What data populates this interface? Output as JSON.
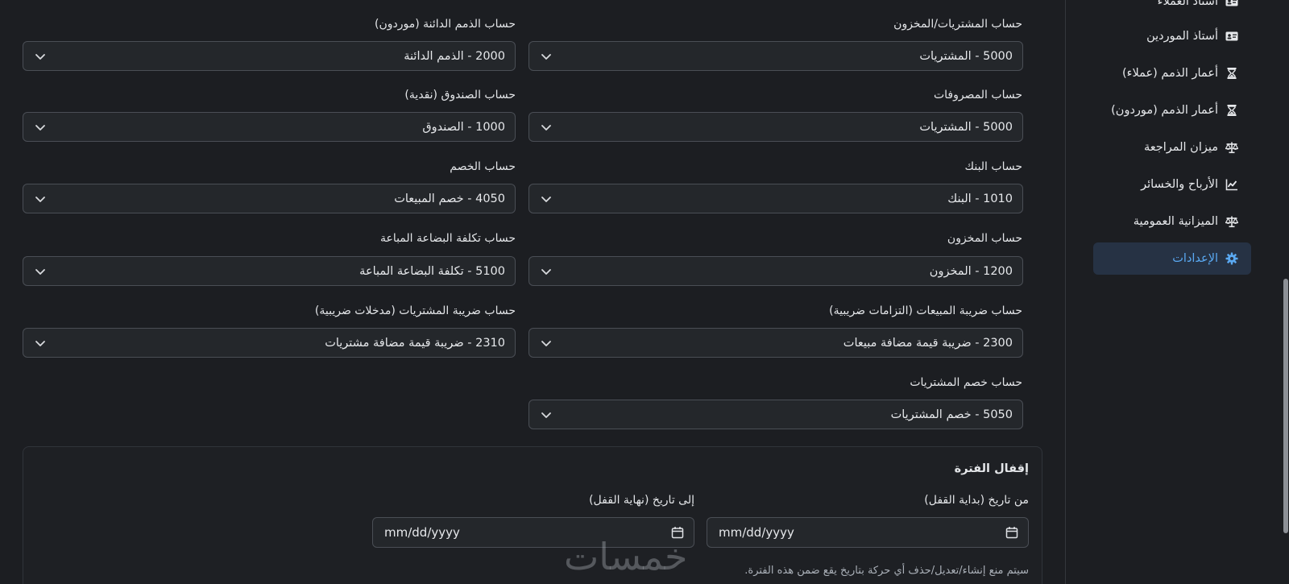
{
  "accounts": {
    "payables_label": "حساب الذمم الدائنة (موردون)",
    "payables_value": "2000 - الذمم الدائنة",
    "purchases_label": "حساب المشتريات/المخزون",
    "purchases_value": "5000 - المشتريات",
    "cash_label": "حساب الصندوق (نقدية)",
    "cash_value": "1000 - الصندوق",
    "expenses_label": "حساب المصروفات",
    "expenses_value": "5000 - المشتريات",
    "discount_label": "حساب الخصم",
    "discount_value": "4050 - خصم المبيعات",
    "bank_label": "حساب البنك",
    "bank_value": "1010 - البنك",
    "cogs_label": "حساب تكلفة البضاعة المباعة",
    "cogs_value": "5100 - تكلفة البضاعة المباعة",
    "inventory_label": "حساب المخزون",
    "inventory_value": "1200 - المخزون",
    "purchase_tax_label": "حساب ضريبة المشتريات (مدخلات ضريبية)",
    "purchase_tax_value": "2310 - ضريبة قيمة مضافة مشتريات",
    "sales_tax_label": "حساب ضريبة المبيعات (التزامات ضريبية)",
    "sales_tax_value": "2300 - ضريبة قيمة مضافة مبيعات",
    "purchase_discount_label": "حساب خصم المشتريات",
    "purchase_discount_value": "5050 - خصم المشتريات"
  },
  "period_lock": {
    "title": "إقفال الفترة",
    "from_label": "من تاريخ (بداية القفل)",
    "from_placeholder": "mm/dd/yyyy",
    "to_label": "إلى تاريخ (نهاية القفل)",
    "to_placeholder": "mm/dd/yyyy",
    "help": "سيتم منع إنشاء/تعديل/حذف أي حركة بتاريخ يقع ضمن هذه الفترة."
  },
  "watermark": "خمسات",
  "sidebar": {
    "items": [
      {
        "label": "أستاذ العملاء",
        "icon": "id-card-icon"
      },
      {
        "label": "أستاذ الموردين",
        "icon": "id-card-icon"
      },
      {
        "label": "أعمار الذمم (عملاء)",
        "icon": "hourglass-icon"
      },
      {
        "label": "أعمار الذمم (موردون)",
        "icon": "hourglass-icon"
      },
      {
        "label": "ميزان المراجعة",
        "icon": "scale-icon"
      },
      {
        "label": "الأرباح والخسائر",
        "icon": "line-chart-icon"
      },
      {
        "label": "الميزانية العمومية",
        "icon": "scale-icon"
      },
      {
        "label": "الإعدادات",
        "icon": "gear-icon",
        "active": true
      }
    ]
  },
  "colors": {
    "accent": "#5aa9f2",
    "active_bg": "#263244",
    "background": "#1c1e22"
  }
}
